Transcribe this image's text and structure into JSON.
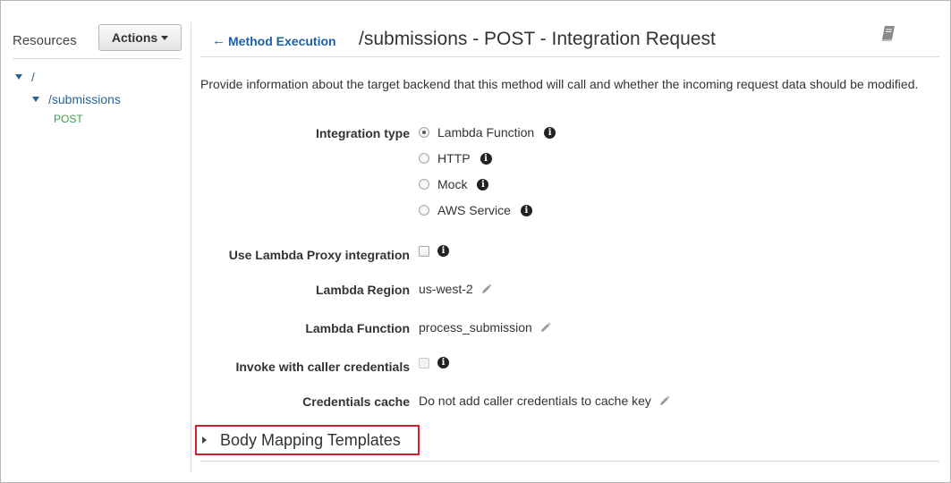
{
  "sidebar": {
    "title": "Resources",
    "actions_label": "Actions",
    "tree": {
      "root": "/",
      "child": "/submissions",
      "method": "POST"
    }
  },
  "header": {
    "back_label": "Method Execution",
    "title": "/submissions - POST - Integration Request"
  },
  "description": "Provide information about the target backend that this method will call and whether the incoming request data should be modified.",
  "form": {
    "integration_type_label": "Integration type",
    "integration_options": [
      {
        "label": "Lambda Function",
        "selected": true
      },
      {
        "label": "HTTP",
        "selected": false
      },
      {
        "label": "Mock",
        "selected": false
      },
      {
        "label": "AWS Service",
        "selected": false
      }
    ],
    "proxy_label": "Use Lambda Proxy integration",
    "proxy_checked": false,
    "region_label": "Lambda Region",
    "region_value": "us-west-2",
    "function_label": "Lambda Function",
    "function_value": "process_submission",
    "invoke_label": "Invoke with caller credentials",
    "invoke_checked": false,
    "cache_label": "Credentials cache",
    "cache_value": "Do not add caller credentials to cache key"
  },
  "body_mapping_label": "Body Mapping Templates",
  "colors": {
    "link": "#1f5fa8",
    "method": "#3a9f4a",
    "highlight": "#d0202a"
  },
  "icons": [
    "chevron-down-icon",
    "arrow-left-icon",
    "book-icon",
    "info-icon",
    "pencil-icon",
    "caret-right-icon"
  ]
}
